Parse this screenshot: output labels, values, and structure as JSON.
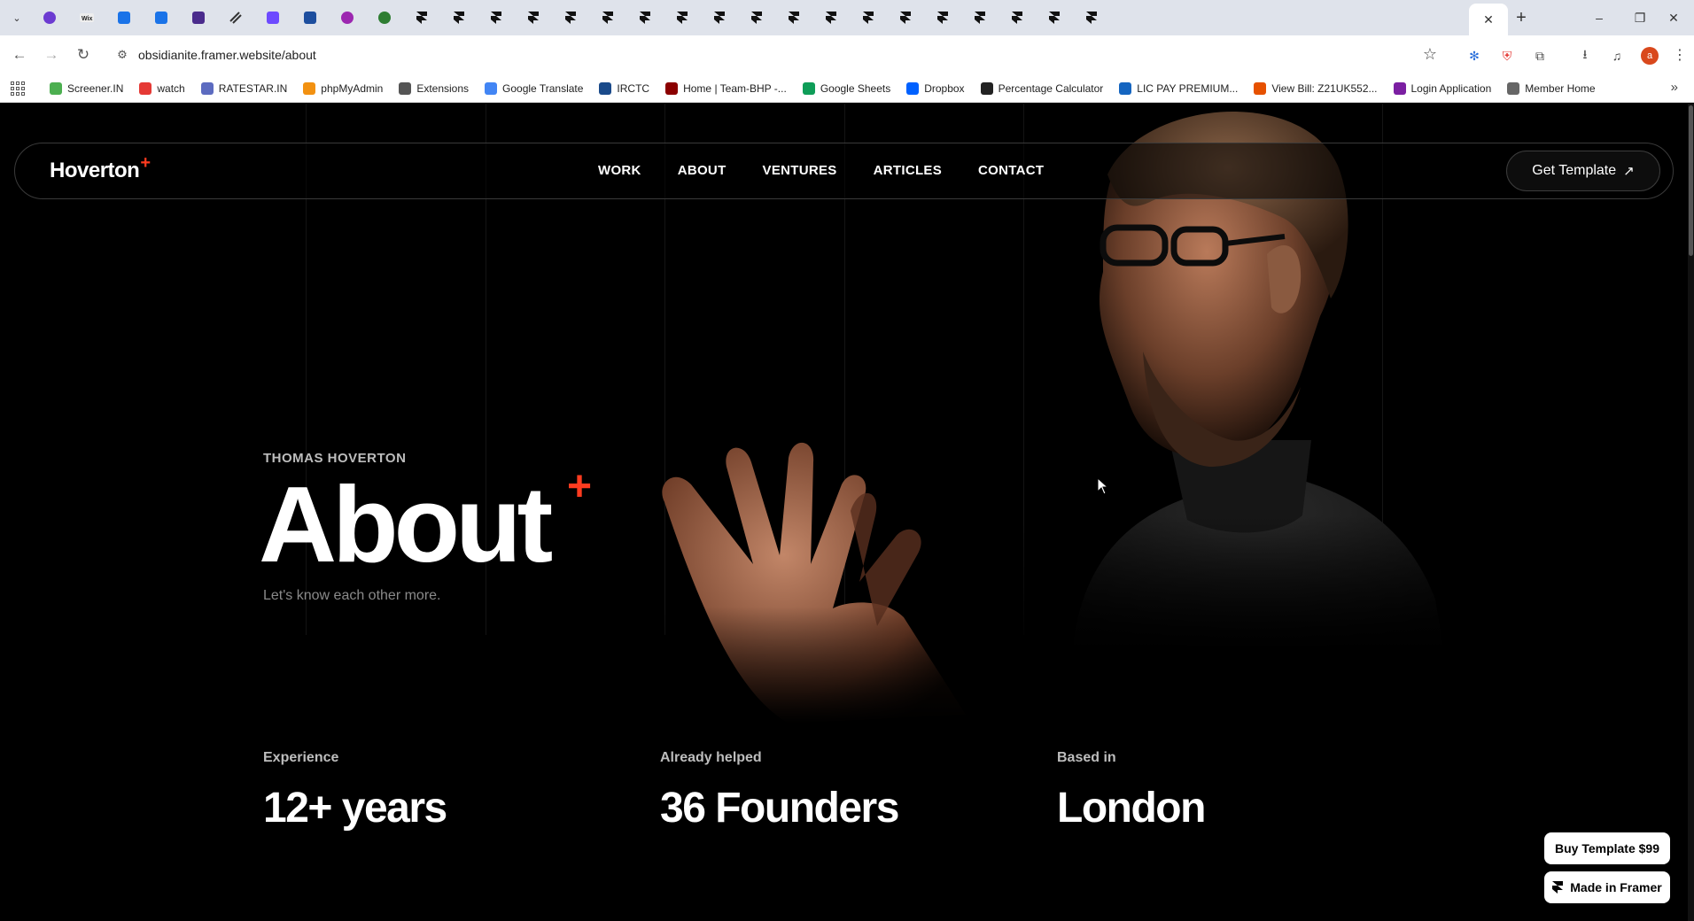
{
  "browser": {
    "url": "obsidianite.framer.website/about",
    "tab_count_icons": 29,
    "bookmarks": [
      {
        "label": "Screener.IN",
        "color": "#4caf50"
      },
      {
        "label": "watch",
        "color": "#e53935"
      },
      {
        "label": "RATESTAR.IN",
        "color": "#5c6bc0"
      },
      {
        "label": "phpMyAdmin",
        "color": "#f29111"
      },
      {
        "label": "Extensions",
        "color": "#555555"
      },
      {
        "label": "Google Translate",
        "color": "#4285f4"
      },
      {
        "label": "IRCTC",
        "color": "#1a4a8a"
      },
      {
        "label": "Home | Team-BHP -...",
        "color": "#8b0000"
      },
      {
        "label": "Google Sheets",
        "color": "#0f9d58"
      },
      {
        "label": "Dropbox",
        "color": "#0061ff"
      },
      {
        "label": "Percentage Calculator",
        "color": "#222222"
      },
      {
        "label": "LIC PAY PREMIUM...",
        "color": "#1565c0"
      },
      {
        "label": "View Bill: Z21UK552...",
        "color": "#e65100"
      },
      {
        "label": "Login Application",
        "color": "#7b1fa2"
      },
      {
        "label": "Member Home",
        "color": "#666666"
      }
    ],
    "profile_initial": "a"
  },
  "nav": {
    "logo": "Hoverton",
    "logo_mark": "+",
    "items": [
      "WORK",
      "ABOUT",
      "VENTURES",
      "ARTICLES",
      "CONTACT"
    ],
    "cta": "Get Template",
    "cta_icon": "arrow-up-right-icon"
  },
  "hero": {
    "eyebrow": "THOMAS HOVERTON",
    "title": "About",
    "title_mark": "+",
    "subtitle": "Let's know each other more."
  },
  "stats": [
    {
      "label": "Experience",
      "value": "12+ years"
    },
    {
      "label": "Already helped",
      "value": "36 Founders"
    },
    {
      "label": "Based in",
      "value": "London"
    }
  ],
  "badges": {
    "buy": "Buy Template $99",
    "made": "Made in Framer"
  },
  "colors": {
    "accent": "#ff3b1f",
    "background": "#000000"
  }
}
